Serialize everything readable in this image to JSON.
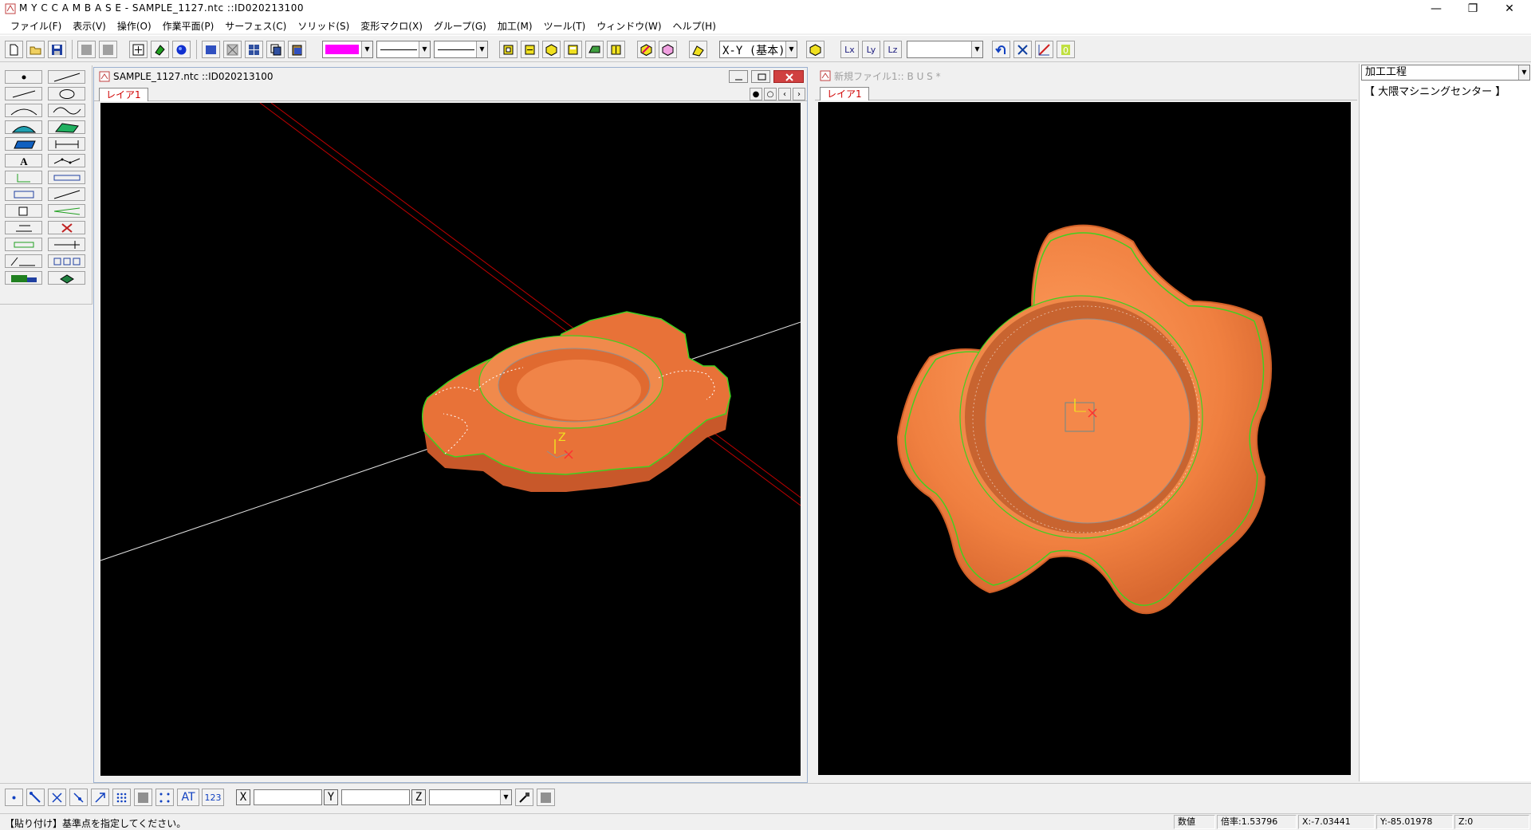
{
  "window": {
    "title": "M Y C  C A M B A S E - SAMPLE_1127.ntc ::ID020213100",
    "minimize": "—",
    "maximize": "❐",
    "close": "✕"
  },
  "menu": [
    "ファイル(F)",
    "表示(V)",
    "操作(O)",
    "作業平面(P)",
    "サーフェス(C)",
    "ソリッド(S)",
    "変形マクロ(X)",
    "グループ(G)",
    "加工(M)",
    "ツール(T)",
    "ウィンドウ(W)",
    "ヘルプ(H)"
  ],
  "toolbar": {
    "plane_combo": "X-Y (基本)",
    "color_accent": "#ff00ff",
    "lx": "Lx",
    "ly": "Ly",
    "lz": "Lz"
  },
  "left_window": {
    "title": "SAMPLE_1127.ntc ::ID020213100",
    "layer_tab": "レイア1",
    "nav_buttons": [
      "●",
      "○",
      "‹",
      "›"
    ],
    "axis_label": "Z"
  },
  "right_window": {
    "title": "新規ファイル1:: B U S *",
    "layer_tab": "レイア1"
  },
  "right_panel": {
    "dropdown": "加工工程",
    "item": "【 大隈マシニングセンター 】"
  },
  "bottom_toolbar": {
    "at_label": "AT",
    "num_label": "123",
    "x_label": "X",
    "y_label": "Y",
    "z_label": "Z"
  },
  "status": {
    "message": "【貼り付け】基準点を指定してください。",
    "mode": "数値",
    "scale": "倍率:1.53796",
    "x": "X:-7.03441",
    "y": "Y:-85.01978",
    "z": "Z:0"
  },
  "colors": {
    "part_orange": "#f08040",
    "edge_green": "#40d020",
    "layer_red": "#d00000",
    "viewport_bg": "#000000"
  }
}
